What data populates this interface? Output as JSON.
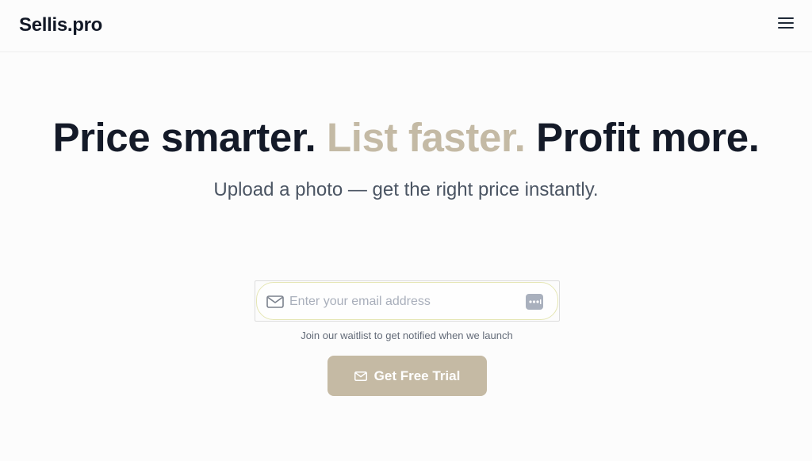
{
  "header": {
    "logo": "Sellis.pro",
    "menu_icon": "hamburger-menu-icon"
  },
  "hero": {
    "headline_part1": "Price smarter.",
    "headline_part2": "List faster.",
    "headline_part3": "Profit more.",
    "subheadline": "Upload a photo — get the right price instantly."
  },
  "waitlist": {
    "email_placeholder": "Enter your email address",
    "email_value": "",
    "email_icon": "mail-icon",
    "password_manager_icon": "password-dots-icon",
    "helper_text": "Join our waitlist to get notified when we launch",
    "cta_label": "Get Free Trial",
    "cta_icon": "mail-icon"
  },
  "colors": {
    "accent": "#c4baa5",
    "text_dark": "#141a28",
    "text_muted": "#4b5563",
    "background": "#fcfcfc"
  }
}
